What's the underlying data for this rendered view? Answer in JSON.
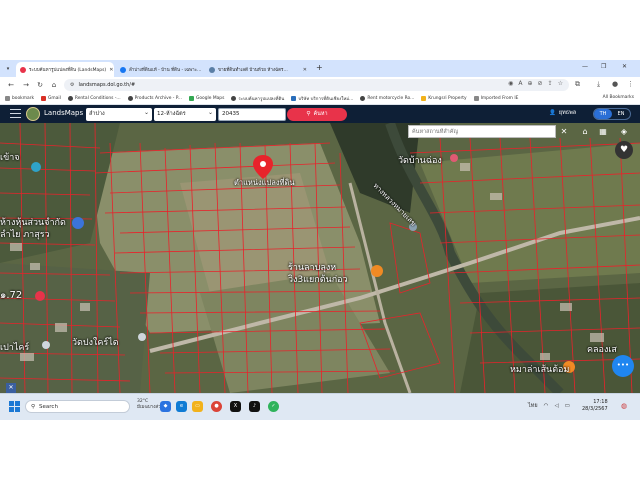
{
  "browser": {
    "tabs": [
      {
        "label": "ระบบค้นหารูปแปลงที่ดิน (LandsMaps)",
        "active": true,
        "favicon_color": "#e8334a"
      },
      {
        "label": "ลำปางที่ดินแท้ - บ้าน ที่ดิน - เฉพาะ...",
        "active": false,
        "favicon_color": "#1877f2"
      },
      {
        "label": "ขายที่ดินทำเลดี บ้านห้วย ห้างฉัตร...",
        "active": false,
        "favicon_color": "#5b7fa6"
      }
    ],
    "url": "landsmaps.dol.go.th/#",
    "bookmarks": [
      {
        "label": "bookmark",
        "icon": "folder-icon"
      },
      {
        "label": "Gmail",
        "icon": "gmail-icon"
      },
      {
        "label": "Rental Conditions -...",
        "icon": "globe-icon"
      },
      {
        "label": "Products Archive - P...",
        "icon": "globe-icon"
      },
      {
        "label": "Google Maps",
        "icon": "maps-icon"
      },
      {
        "label": "ระบบค้นหารูปแปลงที่ดิน",
        "icon": "globe-icon"
      },
      {
        "label": "บริษัท บริการที่ดินเชียงใหม่...",
        "icon": "site-icon"
      },
      {
        "label": "Rent motorcycle Ro...",
        "icon": "globe-icon"
      },
      {
        "label": "Krungsri Property",
        "icon": "site-icon"
      },
      {
        "label": "Imported From IE",
        "icon": "folder-icon"
      }
    ],
    "all_bookmarks": "All Bookmarks"
  },
  "app": {
    "brand": "LandsMaps",
    "province": "ลำปาง",
    "district": "12-ห้างฉัตร",
    "parcel_number": "20435",
    "search_label": "ค้นหา",
    "user_name": "ยุทธพล",
    "lang_th": "TH",
    "lang_en": "EN"
  },
  "map": {
    "place_search_placeholder": "ค้นหาสถานที่สำคัญ",
    "labels": {
      "pin": "ตำแหน่งแปลงที่ดิน",
      "temple_top": "วัดบ้านฉ่อง",
      "road_label": "ทางหลวงหมายเลข",
      "junction": "ร้านลาบลุงห",
      "junction2": "วิง3แยกต้นก่อว",
      "left_a": "ห้างหุ้นส่วนจำกัด",
      "left_b": "ลำไย ภาสุรว",
      "left_c": "เข้าจ",
      "left_d": "๑.72",
      "left_e": "เปาไคร์",
      "temple_bottom": "วัดปงใคร์ได",
      "bottom_right_a": "คลองเส",
      "bottom_right_b": "หมาล่าเส้นต้อม"
    }
  },
  "taskbar": {
    "search": "Search",
    "weather_temp": "32°C",
    "weather_desc": "มีเมฆบางส่วน",
    "tray_lang": "ไทย",
    "time": "17:18",
    "date": "28/3/2567"
  },
  "colors": {
    "parcel_line": "#e8232b",
    "appbar": "#0e1f36",
    "search_button": "#e8334a",
    "chat_button": "#1f86f0"
  }
}
